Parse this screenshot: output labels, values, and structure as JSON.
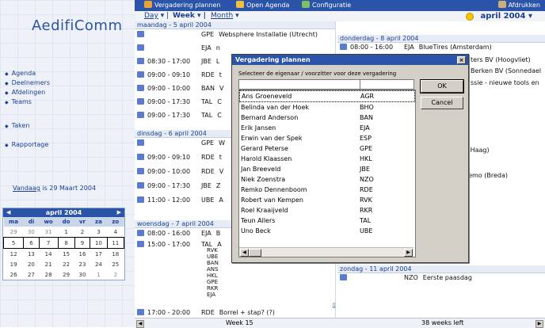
{
  "topbar": {
    "new_meeting": "Vergadering plannen",
    "open_agenda": "Open Agenda",
    "config": "Configuratie",
    "print": "Afdrukken"
  },
  "viewbar": {
    "day": "Day",
    "week": "Week",
    "month": "Month",
    "current_month": "april 2004"
  },
  "sidebar": {
    "logo": "AedifiComm",
    "nav": [
      "Agenda",
      "Deelnemers",
      "Afdelingen",
      "Teams",
      "Taken",
      "Rapportage"
    ],
    "today_link": "Vandaag",
    "today_rest": " is 29 Maart 2004"
  },
  "minical": {
    "title": "april 2004",
    "dow": [
      "ma",
      "di",
      "wo",
      "do",
      "vr",
      "za",
      "zo"
    ],
    "weeks": [
      [
        "29",
        "30",
        "31",
        "1",
        "2",
        "3",
        "4"
      ],
      [
        "5",
        "6",
        "7",
        "8",
        "9",
        "10",
        "11"
      ],
      [
        "12",
        "13",
        "14",
        "15",
        "16",
        "17",
        "18"
      ],
      [
        "19",
        "20",
        "21",
        "22",
        "23",
        "24",
        "25"
      ],
      [
        "26",
        "27",
        "28",
        "29",
        "30",
        "1",
        "2"
      ]
    ]
  },
  "calendar": {
    "monday_header": "maandag - 5 april 2004",
    "monday_rows": [
      {
        "time": "",
        "code": "GPE",
        "text": "Websphere Installatie (Utrecht)"
      },
      {
        "time": "",
        "code": "EJA",
        "text": "n"
      },
      {
        "time": "08:30 - 17:00",
        "code": "JBE",
        "text": "L"
      },
      {
        "time": "09:00 - 09:10",
        "code": "RDE",
        "text": "t"
      },
      {
        "time": "09:00 - 10:00",
        "code": "BAN",
        "text": "V"
      },
      {
        "time": "09:00 - 17:30",
        "code": "TAL",
        "text": "C"
      },
      {
        "time": "09:00 - 17:30",
        "code": "TAL",
        "text": "C"
      }
    ],
    "tuesday_header": "dinsdag - 6 april 2004",
    "tuesday_rows": [
      {
        "time": "",
        "code": "GPE",
        "text": "W"
      },
      {
        "time": "09:00 - 09:10",
        "code": "RDE",
        "text": "t"
      },
      {
        "time": "09:00 - 10:00",
        "code": "RDE",
        "text": "V"
      },
      {
        "time": "09:00 - 17:30",
        "code": "JBE",
        "text": "Z"
      },
      {
        "time": "11:00 - 12:00",
        "code": "UBE",
        "text": "A"
      }
    ],
    "wednesday_header": "woensdag - 7 april 2004",
    "wednesday_rows": [
      {
        "time": "08:00 - 16:00",
        "code": "EJA",
        "text": "B"
      },
      {
        "time": "15:00 - 17:00",
        "code": "TAL",
        "text": "A"
      }
    ],
    "wednesday_codes": [
      "RVK",
      "UBE",
      "BAN",
      "ANS",
      "HKL",
      "GPE",
      "RKR",
      "EJA"
    ],
    "wednesday_last": {
      "time": "17:00 - 20:00",
      "code": "RDE",
      "text": "Borrel + stap? (?)"
    },
    "thursday_header": "donderdag - 8 april 2004",
    "thursday_rows": [
      {
        "time": "08:00 - 16:00",
        "code": "EJA",
        "text": "BlueTires (Amsterdam)"
      }
    ],
    "right_fragments": [
      "ters BV (Hoogvliet)",
      "Berken BV (Sonnedael",
      "ssie - nieuwe tools en",
      "n Haag)",
      "demo  (Breda)"
    ],
    "sunday_header": "zondag - 11 april 2004",
    "sunday_rows": [
      {
        "time": "",
        "code": "NZO",
        "text": "Eerste paasdag"
      }
    ]
  },
  "bottombar": {
    "week": "Week 15",
    "left": "38 weeks left"
  },
  "dialog": {
    "title": "Vergadering plannen",
    "prompt": "Selecteer de eigenaar / voorzitter voor deze vergadering",
    "ok": "OK",
    "cancel": "Cancel",
    "people": [
      {
        "name": "Ans Groeneveld",
        "code": "AGR"
      },
      {
        "name": "Belinda van der Hoek",
        "code": "BHO"
      },
      {
        "name": "Bernard Anderson",
        "code": "BAN"
      },
      {
        "name": "Erik Jansen",
        "code": "EJA"
      },
      {
        "name": "Erwin van der Spek",
        "code": "ESP"
      },
      {
        "name": "Gerard Peterse",
        "code": "GPE"
      },
      {
        "name": "Harold Klaassen",
        "code": "HKL"
      },
      {
        "name": "Jan Breeveld",
        "code": "JBE"
      },
      {
        "name": "Niek Zoenstra",
        "code": "NZO"
      },
      {
        "name": "Remko  Dennenboom",
        "code": "RDE"
      },
      {
        "name": "Robert van Kempen",
        "code": "RVK"
      },
      {
        "name": "Roel Kraaijveld",
        "code": "RKR"
      },
      {
        "name": "Teun Allers",
        "code": "TAL"
      },
      {
        "name": "Uno Beck",
        "code": "UBE"
      }
    ]
  },
  "colors": {
    "accent": "#2b54a8",
    "dialog_bg": "#d4d0c8"
  }
}
